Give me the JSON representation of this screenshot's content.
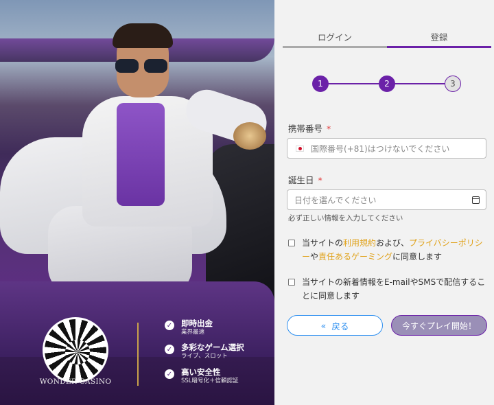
{
  "tabs": {
    "login": "ログイン",
    "register": "登録"
  },
  "steps": [
    "1",
    "2",
    "3"
  ],
  "form": {
    "phone": {
      "label": "携帯番号",
      "required": "*",
      "placeholder": "国際番号(+81)はつけないでください"
    },
    "birthday": {
      "label": "誕生日",
      "required": "*",
      "placeholder": "日付を選んでください"
    },
    "hint": "必ず正しい情報を入力してください"
  },
  "consent_terms": {
    "part1": "当サイトの",
    "link1": "利用規約",
    "part2": "および、",
    "link2": "プライバシーポリシー",
    "part3": "や",
    "link3": "責任あるゲーミング",
    "part4": "に同意します"
  },
  "consent_news": "当サイトの新着情報をE-mailやSMSで配信することに同意します",
  "buttons": {
    "back_icon": "«",
    "back": "戻る",
    "play": "今すぐプレイ開始！"
  },
  "brand": {
    "name": "WONDER CASINO"
  },
  "features": [
    {
      "title": "即時出金",
      "sub": "業界最速"
    },
    {
      "title": "多彩なゲーム選択",
      "sub": "ライブ、スロット"
    },
    {
      "title": "高い安全性",
      "sub": "SSL暗号化＋信頼認証"
    }
  ],
  "icons": {
    "flag": "japan-flag-icon",
    "calendar": "calendar-icon",
    "check": "check-circle-icon"
  },
  "colors": {
    "accent": "#6b21a8",
    "link": "#e0a21a",
    "back": "#2d8ff0",
    "divider": "#c9a24b"
  }
}
